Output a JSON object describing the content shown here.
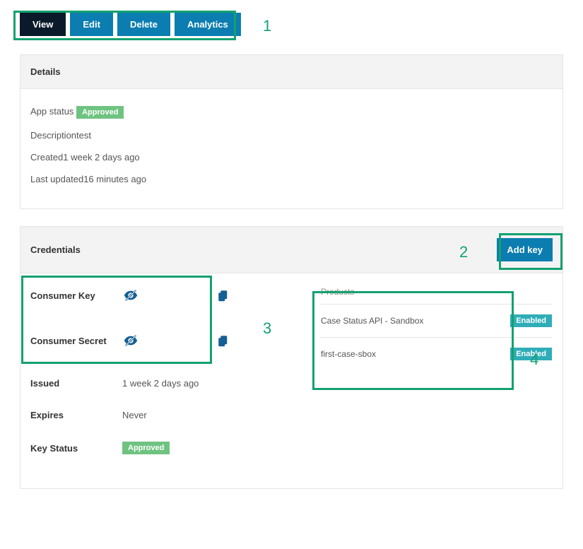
{
  "tabs": {
    "view": "View",
    "edit": "Edit",
    "delete": "Delete",
    "analytics": "Analytics"
  },
  "details": {
    "header": "Details",
    "app_status_label": "App status",
    "app_status_value": "Approved",
    "description_label": "Description",
    "description_value": "test",
    "created_label": "Created",
    "created_value": "1 week 2 days ago",
    "last_updated_label": "Last updated",
    "last_updated_value": "16 minutes ago"
  },
  "credentials": {
    "header": "Credentials",
    "add_key_label": "Add key",
    "consumer_key_label": "Consumer Key",
    "consumer_secret_label": "Consumer Secret",
    "issued_label": "Issued",
    "issued_value": "1 week 2 days ago",
    "expires_label": "Expires",
    "expires_value": "Never",
    "key_status_label": "Key Status",
    "key_status_value": "Approved",
    "products_header": "Products",
    "products": [
      {
        "name": "Case Status API - Sandbox",
        "status": "Enabled"
      },
      {
        "name": "first-case-sbox",
        "status": "Enabled"
      }
    ]
  },
  "annotations": {
    "a1": "1",
    "a2": "2",
    "a3": "3",
    "a4": "4"
  }
}
